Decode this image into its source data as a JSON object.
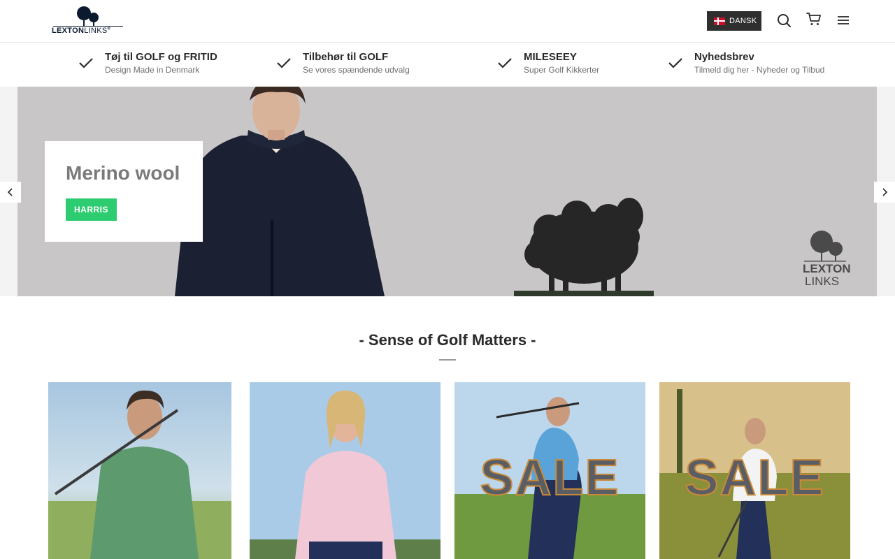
{
  "header": {
    "logo": {
      "brand_bold": "LEXTON",
      "brand_thin": "LINKS"
    },
    "language_button": {
      "label": "DANSK",
      "flag_icon": "denmark-flag-icon"
    },
    "icons": [
      "search-icon",
      "cart-icon",
      "menu-icon"
    ]
  },
  "usp_bar": {
    "items": [
      {
        "title": "Tøj til GOLF og FRITID",
        "subtitle": "Design Made in Denmark",
        "icon": "check-icon"
      },
      {
        "title": "Tilbehør til GOLF",
        "subtitle": "Se vores spændende udvalg",
        "icon": "check-icon"
      },
      {
        "title": "MILESEEY",
        "subtitle": "Super Golf Kikkerter",
        "icon": "check-icon"
      },
      {
        "title": "Nyhedsbrev",
        "subtitle": "Tilmeld dig her - Nyheder og Tilbud",
        "icon": "check-icon"
      }
    ]
  },
  "hero": {
    "title": "Merino wool",
    "button_label": "HARRIS",
    "logo": {
      "line1": "LEXTON",
      "line2": "LINKS"
    },
    "prev_icon": "chevron-left-icon",
    "next_icon": "chevron-right-icon"
  },
  "section": {
    "title": "- Sense of Golf Matters -"
  },
  "products": [
    {
      "overlay": ""
    },
    {
      "overlay": ""
    },
    {
      "overlay": "SALE"
    },
    {
      "overlay": "SALE"
    }
  ],
  "colors": {
    "accent_green": "#2dcc70",
    "header_button_bg": "#2f2f2f",
    "hero_bg": "#c9c6c7",
    "brand_navy": "#0c1a30"
  }
}
